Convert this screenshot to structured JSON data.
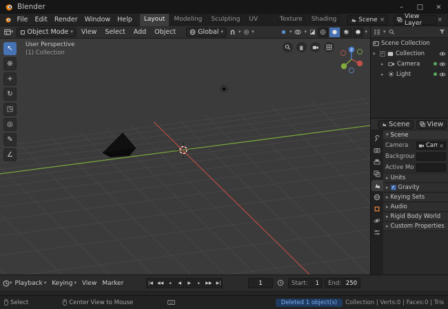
{
  "colors": {
    "accent": "#4772b3",
    "axis_x": "#b04a44",
    "axis_y": "#76a33c",
    "axis_z": "#4a80d0",
    "message_text": "#7db1f5"
  },
  "icons": {
    "caret_down": "▾",
    "caret_right": "▸",
    "check": "✓",
    "close": "×",
    "minimize": "–",
    "maximize": "□",
    "clear": "×",
    "xray": "◪"
  },
  "window": {
    "title": "Blender"
  },
  "topbar": {
    "menus": [
      {
        "label": "File"
      },
      {
        "label": "Edit"
      },
      {
        "label": "Render"
      },
      {
        "label": "Window"
      },
      {
        "label": "Help"
      }
    ],
    "tabs": [
      {
        "label": "Layout"
      },
      {
        "label": "Modeling"
      },
      {
        "label": "Sculpting"
      },
      {
        "label": "UV Editing"
      },
      {
        "label": "Texture Paint"
      },
      {
        "label": "Shading"
      }
    ],
    "scene_selector": {
      "label": "Scene"
    },
    "view_layer_selector": {
      "label": "View Layer"
    }
  },
  "tool_header": {
    "mode": "Object Mode",
    "menus": [
      {
        "label": "View"
      },
      {
        "label": "Select"
      },
      {
        "label": "Add"
      },
      {
        "label": "Object"
      }
    ],
    "orientation": "Global"
  },
  "viewport": {
    "overlay": {
      "title": "User Perspective",
      "subtitle": "(1) Collection"
    },
    "tools": [
      {
        "name": "tweak-select",
        "glyph": "↖"
      },
      {
        "name": "cursor",
        "glyph": "⊕"
      },
      {
        "name": "move",
        "glyph": "+"
      },
      {
        "name": "rotate",
        "glyph": "↻"
      },
      {
        "name": "scale",
        "glyph": "◳"
      },
      {
        "name": "transform",
        "glyph": "◎"
      },
      {
        "name": "annotate",
        "glyph": "✎"
      },
      {
        "name": "measure",
        "glyph": "∠"
      }
    ]
  },
  "outliner": {
    "rows": [
      {
        "label": "Scene Collection"
      },
      {
        "label": "Collection"
      },
      {
        "label": "Camera"
      },
      {
        "label": "Light"
      }
    ]
  },
  "properties": {
    "breadcrumb": {
      "scene": "Scene",
      "view_layer": "View"
    },
    "scene_section": "Scene",
    "fields": [
      {
        "label": "Camera",
        "value": "Cam.."
      },
      {
        "label": "Backgroun..",
        "value": ""
      },
      {
        "label": "Active Mo..",
        "value": ""
      }
    ],
    "panels": [
      {
        "label": "Units"
      },
      {
        "label": "Gravity",
        "checked": true
      },
      {
        "label": "Keying Sets"
      },
      {
        "label": "Audio"
      },
      {
        "label": "Rigid Body World"
      },
      {
        "label": "Custom Properties"
      }
    ]
  },
  "timeline": {
    "menus": [
      {
        "label": "Playback"
      },
      {
        "label": "Keying"
      },
      {
        "label": "View"
      },
      {
        "label": "Marker"
      }
    ],
    "transport": [
      {
        "name": "jump-to-start",
        "glyph": "|◀"
      },
      {
        "name": "prev-keyframe",
        "glyph": "◀◀"
      },
      {
        "name": "prev-frame",
        "glyph": "◂"
      },
      {
        "name": "play-reverse",
        "glyph": "◀"
      },
      {
        "name": "play",
        "glyph": "▶"
      },
      {
        "name": "next-frame",
        "glyph": "▸"
      },
      {
        "name": "next-keyframe",
        "glyph": "▶▶"
      },
      {
        "name": "jump-to-end",
        "glyph": "▶|"
      }
    ],
    "current_frame": "1",
    "start": {
      "label": "Start:",
      "value": "1"
    },
    "end": {
      "label": "End:",
      "value": "250"
    }
  },
  "status_bar": {
    "select_hint": "Select",
    "view_hint": "Center View to Mouse",
    "message": "Deleted 1 object(s)",
    "stats": "Collection | Verts:0 | Faces:0 | Tris"
  }
}
